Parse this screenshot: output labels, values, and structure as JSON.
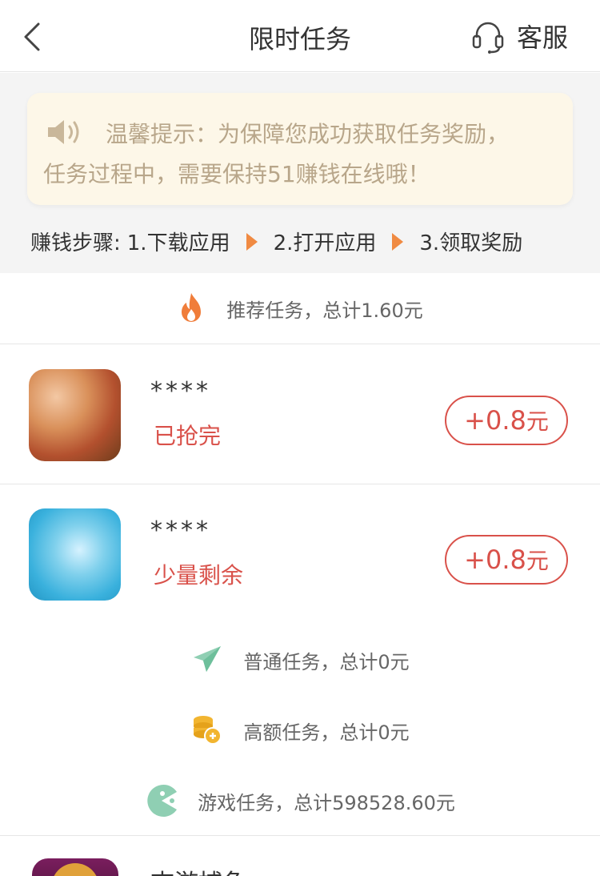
{
  "header": {
    "title": "限时任务",
    "service_label": "客服"
  },
  "tip": {
    "line1": "温馨提示：为保障您成功获取任务奖励，",
    "line2": "任务过程中，需要保持51赚钱在线哦！"
  },
  "steps": {
    "label": "赚钱步骤:",
    "step1": "1.下载应用",
    "step2": "2.打开应用",
    "step3": "3.领取奖励"
  },
  "recommended": {
    "title": "推荐任务，总计1.60元"
  },
  "tasks": [
    {
      "name": "****",
      "status": "已抢完",
      "reward_amount": "+0.8",
      "reward_unit": "元"
    },
    {
      "name": "****",
      "status": "少量剩余",
      "reward_amount": "+0.8",
      "reward_unit": "元"
    }
  ],
  "categories": {
    "normal": "普通任务，总计0元",
    "high": "高额任务，总计0元",
    "game": "游戏任务，总计598528.60元"
  },
  "last_task": {
    "name": "志游捕鱼"
  },
  "colors": {
    "accent_red": "#d9514a",
    "arrow_orange": "#f08a42",
    "tip_bg": "#fdf7e8",
    "tip_text": "#b8a68a"
  }
}
